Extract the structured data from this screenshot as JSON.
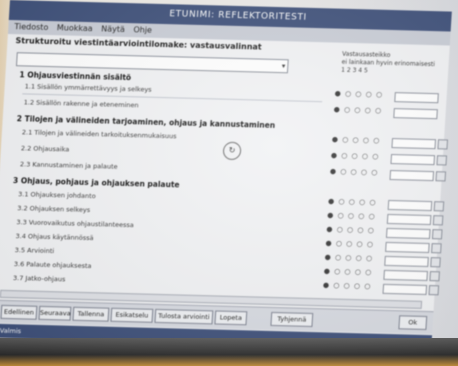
{
  "window": {
    "title": "ETUNIMI: REFLEKTORITESTI"
  },
  "menu": [
    "Tiedosto",
    "Muokkaa",
    "Näytä",
    "Ohje"
  ],
  "form": {
    "title": "Strukturoitu viestintäarviointilomake: vastausvalinnat",
    "dropdown_value": "",
    "scale_header": [
      "Vastausasteikko",
      "ei lainkaan  hyvin  erinomaisesti",
      "1  2  3  4  5"
    ]
  },
  "sections": [
    {
      "title": "1 Ohjausviestinnän sisältö",
      "rows": [
        "1.1 Sisällön ymmärrettävyys ja selkeys",
        "1.2 Sisällön rakenne ja eteneminen"
      ]
    },
    {
      "title": "2 Tilojen ja välineiden tarjoaminen, ohjaus ja kannustaminen",
      "rows": [
        "2.1 Tilojen ja välineiden tarkoituksenmukaisuus",
        "2.2 Ohjausaika",
        "2.3 Kannustaminen ja palaute"
      ]
    },
    {
      "title": "3 Ohjaus, pohjaus ja ohjauksen palaute",
      "rows": [
        "3.1 Ohjauksen johdanto",
        "3.2 Ohjauksen selkeys",
        "3.3 Vuorovaikutus ohjaustilanteessa",
        "3.4 Ohjaus käytännössä",
        "3.5 Arviointi",
        "3.6 Palaute ohjauksesta",
        "3.7 Jatko-ohjaus"
      ]
    }
  ],
  "radio_glyph": "● ○ ○ ○ ○",
  "buttons": [
    "Edellinen",
    "Seuraava",
    "Tallenna",
    "Esikatselu",
    "Tulosta arviointi",
    "Lopeta",
    "Tyhjennä",
    "Ok"
  ],
  "status": {
    "text": "Valmis"
  },
  "cursor_icon": "busy-cursor-icon"
}
